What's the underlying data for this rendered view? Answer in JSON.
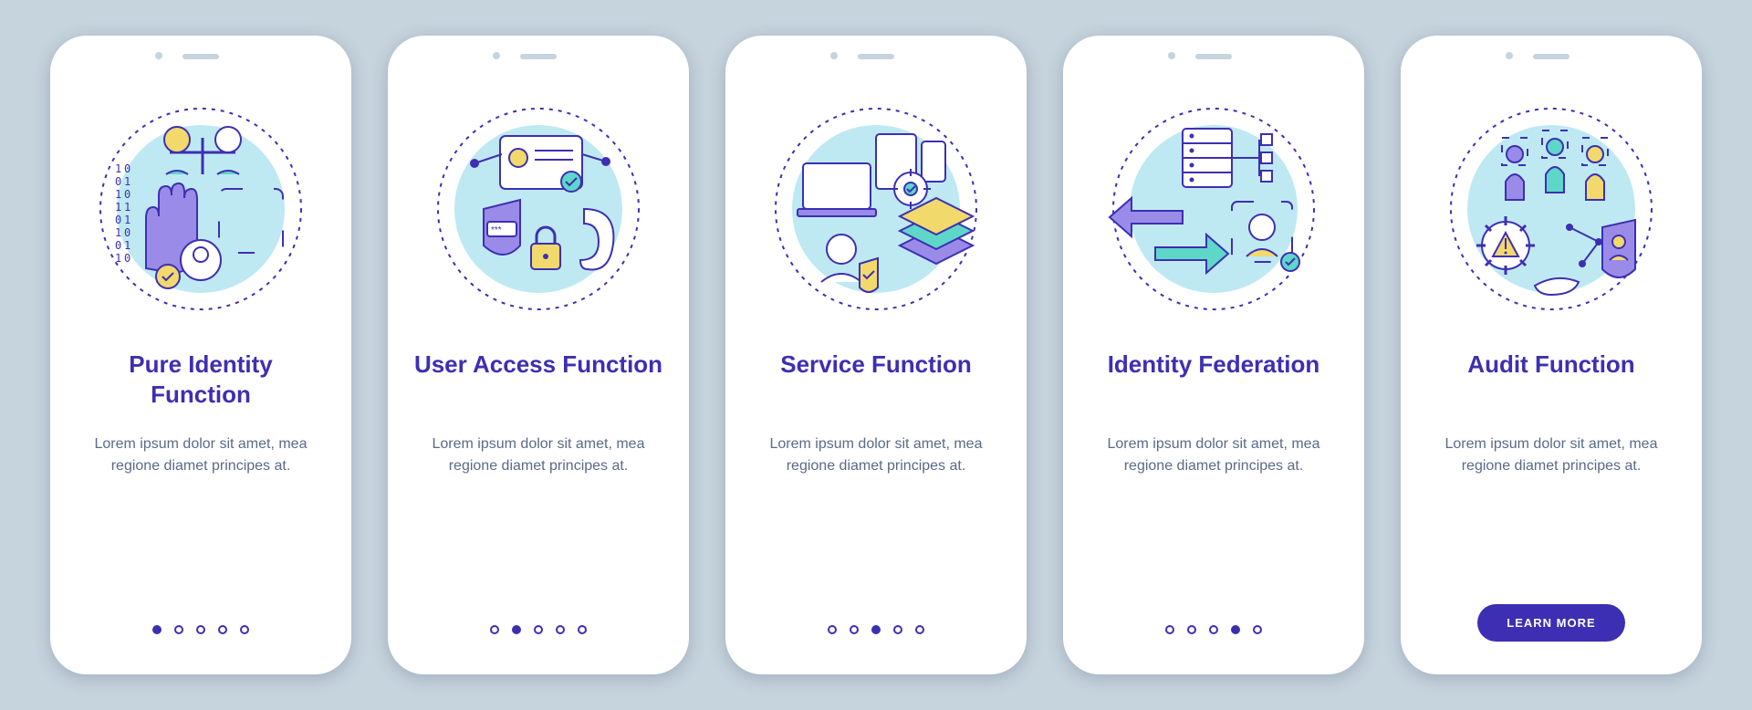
{
  "shared": {
    "description": "Lorem ipsum dolor sit amet, mea regione diamet principes at.",
    "cta_label": "LEARN MORE",
    "total_screens": 5
  },
  "colors": {
    "bg": "#c6d4dd",
    "card": "#ffffff",
    "accent_primary": "#3d2fb3",
    "accent_purple": "#9a8be8",
    "accent_teal": "#5ed6c8",
    "accent_yellow": "#f2d96b",
    "accent_pale_blue": "#bfe9f2",
    "text_muted": "#5a6a87"
  },
  "screens": [
    {
      "index": 0,
      "title": "Pure Identity Function",
      "icon_name": "identity-biometric-icon",
      "active_dot": 0
    },
    {
      "index": 1,
      "title": "User Access Function",
      "icon_name": "user-access-icon",
      "active_dot": 1
    },
    {
      "index": 2,
      "title": "Service Function",
      "icon_name": "service-layers-icon",
      "active_dot": 2
    },
    {
      "index": 3,
      "title": "Identity Federation",
      "icon_name": "federation-arrows-icon",
      "active_dot": 3
    },
    {
      "index": 4,
      "title": "Audit Function",
      "icon_name": "audit-shield-icon",
      "active_dot": 4
    }
  ]
}
